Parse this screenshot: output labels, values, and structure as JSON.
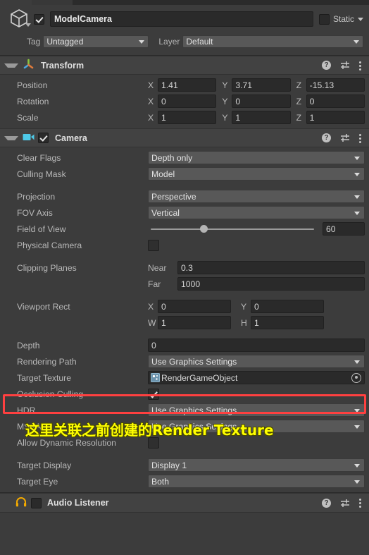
{
  "gameobject": {
    "icon": "cube-icon",
    "enabled": true,
    "name": "ModelCamera",
    "static_label": "Static",
    "static_checked": false,
    "tag_label": "Tag",
    "tag_value": "Untagged",
    "layer_label": "Layer",
    "layer_value": "Default"
  },
  "transform": {
    "title": "Transform",
    "icon": "transform-axis-icon",
    "rows": [
      {
        "label": "Position",
        "x": "1.41",
        "y": "3.71",
        "z": "-15.13"
      },
      {
        "label": "Rotation",
        "x": "0",
        "y": "0",
        "z": "0"
      },
      {
        "label": "Scale",
        "x": "1",
        "y": "1",
        "z": "1"
      }
    ],
    "axis_x": "X",
    "axis_y": "Y",
    "axis_z": "Z"
  },
  "camera": {
    "title": "Camera",
    "icon": "camera-icon",
    "enabled": true,
    "clear_flags_label": "Clear Flags",
    "clear_flags_value": "Depth only",
    "culling_mask_label": "Culling Mask",
    "culling_mask_value": "Model",
    "projection_label": "Projection",
    "projection_value": "Perspective",
    "fov_axis_label": "FOV Axis",
    "fov_axis_value": "Vertical",
    "field_of_view_label": "Field of View",
    "field_of_view_value": "60",
    "field_of_view_percent": 33,
    "physical_camera_label": "Physical Camera",
    "physical_camera_checked": false,
    "clipping_planes_label": "Clipping Planes",
    "clipping_near_label": "Near",
    "clipping_near_value": "0.3",
    "clipping_far_label": "Far",
    "clipping_far_value": "1000",
    "viewport_rect_label": "Viewport Rect",
    "viewport_x_label": "X",
    "viewport_x_value": "0",
    "viewport_y_label": "Y",
    "viewport_y_value": "0",
    "viewport_w_label": "W",
    "viewport_w_value": "1",
    "viewport_h_label": "H",
    "viewport_h_value": "1",
    "depth_label": "Depth",
    "depth_value": "0",
    "rendering_path_label": "Rendering Path",
    "rendering_path_value": "Use Graphics Settings",
    "target_texture_label": "Target Texture",
    "target_texture_value": "RenderGameObject",
    "target_texture_icon": "render-texture-icon",
    "occlusion_culling_label": "Occlusion Culling",
    "occlusion_culling_checked": true,
    "hdr_label": "HDR",
    "hdr_value": "Use Graphics Settings",
    "msaa_label": "MSAA",
    "msaa_value": "Use Graphics Settings",
    "allow_dynamic_resolution_label": "Allow Dynamic Resolution",
    "allow_dynamic_resolution_checked": false,
    "target_display_label": "Target Display",
    "target_display_value": "Display 1",
    "target_eye_label": "Target Eye",
    "target_eye_value": "Both"
  },
  "audio_listener": {
    "title": "Audio Listener",
    "icon": "headphones-icon",
    "enabled": false
  },
  "header_icons": {
    "help": "?",
    "preset": "preset-icon",
    "menu": "kebab-menu-icon"
  },
  "annotation": {
    "text": "这里关联之前创建的Render Texture",
    "color": "#ffff00",
    "highlight_color": "#ff4040",
    "highlight_target": "Target Texture"
  },
  "colors": {
    "background": "#3c3c3c",
    "header_background": "#424242",
    "field_background": "#2a2a2a",
    "dropdown_background": "#585858",
    "text": "#c4c4c4",
    "camera_icon": "#4ec9e8",
    "audio_icon": "#f2a900"
  }
}
